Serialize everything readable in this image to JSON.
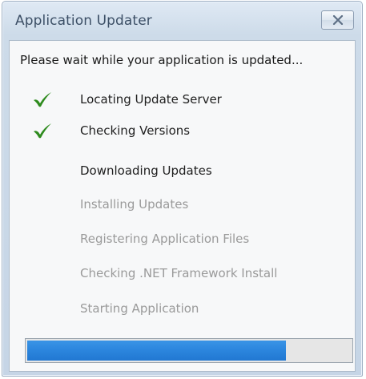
{
  "window": {
    "title": "Application Updater",
    "close_icon": "close-icon"
  },
  "message": "Please wait while your application is updated...",
  "steps": [
    {
      "label": "Locating Update Server",
      "status": "done"
    },
    {
      "label": "Checking Versions",
      "status": "done"
    },
    {
      "label": "Downloading Updates",
      "status": "active"
    },
    {
      "label": "Installing Updates",
      "status": "pending"
    },
    {
      "label": "Registering Application Files",
      "status": "pending"
    },
    {
      "label": "Checking .NET Framework Install",
      "status": "pending"
    },
    {
      "label": "Starting Application",
      "status": "pending"
    }
  ],
  "progress": {
    "value": 0.8,
    "color": "#2c86de"
  },
  "colors": {
    "check": "#2e8b1e",
    "done_text": "#1e1e1e",
    "pending_text": "#9a9a9a"
  }
}
